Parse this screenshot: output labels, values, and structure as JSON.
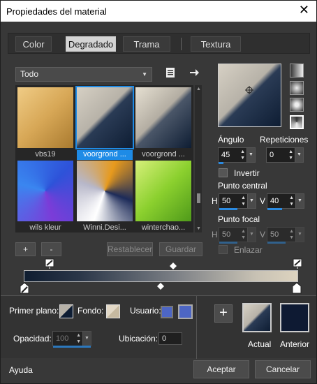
{
  "window": {
    "title": "Propiedades del material",
    "close_glyph": "✕"
  },
  "tabs": [
    {
      "label": "Color",
      "active": false
    },
    {
      "label": "Degradado",
      "active": true
    },
    {
      "label": "Trama",
      "active": false
    },
    {
      "label": "Textura",
      "active": false
    }
  ],
  "category": {
    "value": "Todo"
  },
  "gradients": [
    {
      "name": "vbs19",
      "selected": false,
      "style": "linear-gradient(135deg,#f0cc86 0%,#d7a756 50%,#a97a2f 100%)"
    },
    {
      "name": "voorgrond ...",
      "selected": true,
      "style": "linear-gradient(135deg,#d6d0c4 0%,#b7b2a8 45%,#2a3b55 52%,#0e1d33 100%)"
    },
    {
      "name": "voorgrond ...",
      "selected": false,
      "style": "linear-gradient(135deg,#e6e0d2 0%,#b3ada2 45%,#4a5668 52%,#0e1d33 100%)"
    },
    {
      "name": "wils kleur",
      "selected": false,
      "style": "conic-gradient(from 45deg,#2e52d9,#7b3cd8,#3a86f0,#2e52d9)"
    },
    {
      "name": "Winni.Desi...",
      "selected": false,
      "style": "conic-gradient(from 20deg,#e79a1d,#1d2b59,#ffffff,#b7b7c9,#e79a1d)"
    },
    {
      "name": "winterchao...",
      "selected": false,
      "style": "linear-gradient(135deg,#d7f07a 0%,#8bd02e 50%,#4f9a1a 100%)"
    }
  ],
  "list_buttons": {
    "add": "+",
    "remove": "-",
    "reset": "Restablecer",
    "save": "Guardar"
  },
  "angle": {
    "label": "Ángulo",
    "value": "45",
    "fill": 0.13
  },
  "repeats": {
    "label": "Repeticiones",
    "value": "0",
    "fill": 0.0
  },
  "invert": {
    "label": "Invertir",
    "checked": false
  },
  "center": {
    "label": "Punto central",
    "h_label": "H",
    "h": "50",
    "h_fill": 0.5,
    "v_label": "V",
    "v": "40",
    "v_fill": 0.4
  },
  "focal": {
    "label": "Punto focal",
    "h_label": "H",
    "h": "50",
    "h_fill": 0.5,
    "v_label": "V",
    "v": "50",
    "v_fill": 0.5
  },
  "link": {
    "label": "Enlazar",
    "checked": false
  },
  "materials": {
    "fg_label": "Primer plano:",
    "bg_label": "Fondo:",
    "user_label": "Usuario:"
  },
  "opacity": {
    "label": "Opacidad:",
    "value": "100",
    "fill": 1.0
  },
  "location": {
    "label": "Ubicación:",
    "value": "0"
  },
  "swatches": {
    "current_label": "Actual",
    "previous_label": "Anterior",
    "add": "+",
    "previous_color": "#0e1a33"
  },
  "footer": {
    "help": "Ayuda",
    "ok": "Aceptar",
    "cancel": "Cancelar"
  },
  "colors": {
    "accent": "#1e8be6",
    "dark": "#0e1d33",
    "light": "#d6d0c4"
  }
}
